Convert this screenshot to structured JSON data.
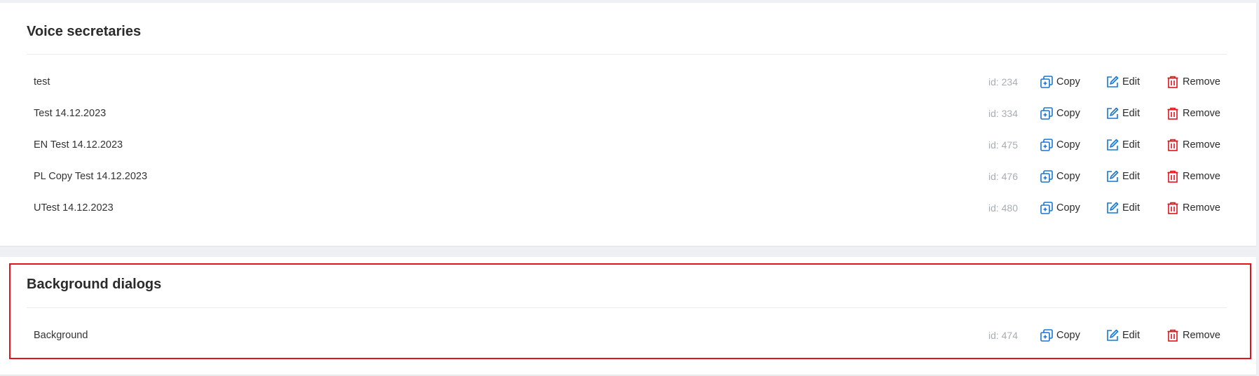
{
  "sections": [
    {
      "title": "Voice secretaries",
      "rows": [
        {
          "name": "test",
          "id": "id: 234"
        },
        {
          "name": "Test 14.12.2023",
          "id": "id: 334"
        },
        {
          "name": "EN Test 14.12.2023",
          "id": "id: 475"
        },
        {
          "name": "PL Copy Test 14.12.2023",
          "id": "id: 476"
        },
        {
          "name": "UTest 14.12.2023",
          "id": "id: 480"
        }
      ]
    },
    {
      "title": "Background dialogs",
      "rows": [
        {
          "name": "Background",
          "id": "id: 474"
        }
      ]
    }
  ],
  "actions": {
    "copy_label": "Copy",
    "edit_label": "Edit",
    "remove_label": "Remove"
  },
  "icons": {
    "copy": "copy-icon",
    "edit": "edit-icon",
    "remove": "trash-icon"
  },
  "colors": {
    "action_blue": "#1976d2",
    "remove_red": "#e3131b",
    "highlight": "#e3131b",
    "id_gray": "#a7adb4"
  }
}
